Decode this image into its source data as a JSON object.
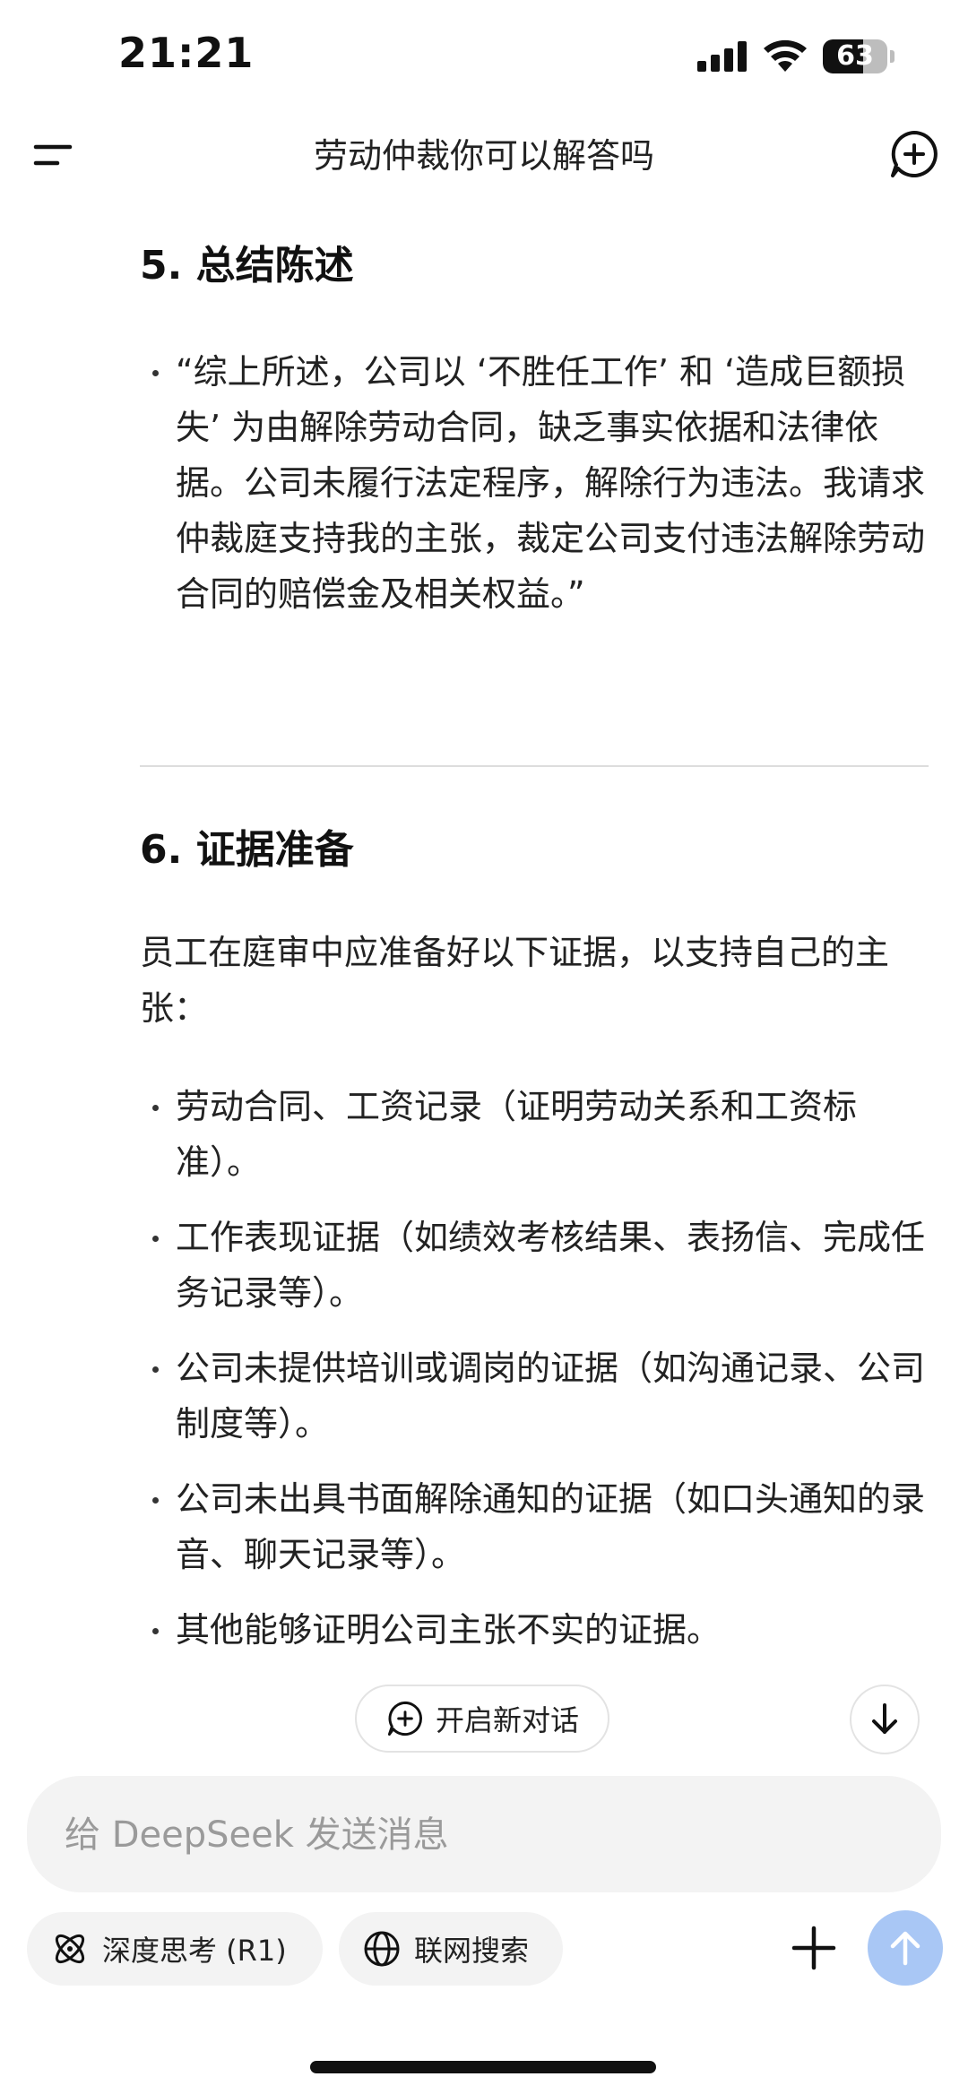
{
  "status_bar": {
    "time": "21:21",
    "battery_level": "63",
    "battery_fraction": 0.63
  },
  "header": {
    "title": "劳动仲裁你可以解答吗",
    "menu_icon": "menu-icon",
    "new_chat_icon": "new-chat-icon"
  },
  "content": {
    "section5": {
      "heading": "5. 总结陈述",
      "bullets": [
        "“综上所述，公司以 ‘不胜任工作’ 和 ‘造成巨额损失’ 为由解除劳动合同，缺乏事实依据和法律依据。公司未履行法定程序，解除行为违法。我请求仲裁庭支持我的主张，裁定公司支付违法解除劳动合同的赔偿金及相关权益。”"
      ]
    },
    "section6": {
      "heading": "6. 证据准备",
      "intro": "员工在庭审中应准备好以下证据，以支持自己的主张：",
      "bullets": [
        "劳动合同、工资记录（证明劳动关系和工资标准）。",
        "工作表现证据（如绩效考核结果、表扬信、完成任务记录等）。",
        "公司未提供培训或调岗的证据（如沟通记录、公司制度等）。",
        "公司未出具书面解除通知的证据（如口头通知的录音、聊天记录等）。",
        "其他能够证明公司主张不实的证据。"
      ]
    }
  },
  "floating": {
    "new_chat_label": "开启新对话",
    "scroll_down_icon": "arrow-down-icon"
  },
  "composer": {
    "placeholder": "给 DeepSeek 发送消息",
    "value": "",
    "deep_think_label": "深度思考 (R1)",
    "web_search_label": "联网搜索",
    "colors": {
      "send_button": "#a9c7f5",
      "chip_bg": "#f3f3f3"
    }
  }
}
